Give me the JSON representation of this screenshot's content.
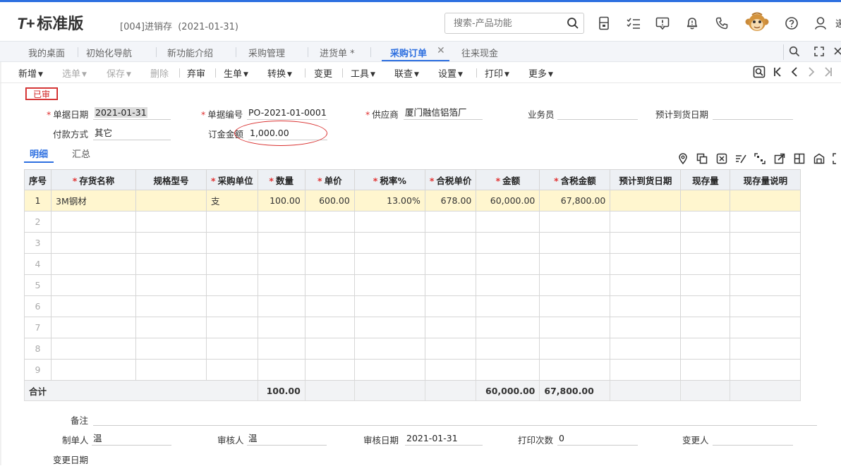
{
  "header": {
    "logo_mark": "T+",
    "logo_text": "标准版",
    "account": "[004]进销存",
    "account_date": "(2021-01-31)",
    "search_placeholder": "搜索-产品功能",
    "cut_text": "递"
  },
  "tabs": [
    {
      "label": "我的桌面"
    },
    {
      "label": "初始化导航"
    },
    {
      "label": "新功能介绍"
    },
    {
      "label": "采购管理"
    },
    {
      "label": "进货单 *"
    },
    {
      "label": "采购订单",
      "active": true
    },
    {
      "label": "往来现金"
    }
  ],
  "tab_close": "✕",
  "toolbar": {
    "new": "新增",
    "select": "选单",
    "save": "保存",
    "delete": "删除",
    "abandon": "弃审",
    "generate": "生单",
    "convert": "转换",
    "change": "变更",
    "tools": "工具",
    "query": "联查",
    "settings": "设置",
    "print": "打印",
    "more": "更多"
  },
  "status": "已审",
  "form": {
    "date_label": "单据日期",
    "date_value": "2021-01-31",
    "code_label": "单据编号",
    "code_value": "PO-2021-01-0001",
    "supplier_label": "供应商",
    "supplier_value": "厦门融信铝箔厂",
    "salesman_label": "业务员",
    "salesman_value": "",
    "arrival_label": "预计到货日期",
    "arrival_value": "",
    "pay_label": "付款方式",
    "pay_value": "其它",
    "deposit_label": "订金金额",
    "deposit_value": "1,000.00"
  },
  "subtabs": {
    "detail": "明细",
    "summary": "汇总"
  },
  "grid": {
    "columns": [
      {
        "label": "序号",
        "req": ""
      },
      {
        "label": "存货名称",
        "req": "*"
      },
      {
        "label": "规格型号",
        "req": ""
      },
      {
        "label": "采购单位",
        "req": "*"
      },
      {
        "label": "数量",
        "req": "*"
      },
      {
        "label": "单价",
        "req": "*"
      },
      {
        "label": "税率%",
        "req": "*"
      },
      {
        "label": "合税单价",
        "req": "*"
      },
      {
        "label": "金额",
        "req": "*"
      },
      {
        "label": "含税金额",
        "req": "*"
      },
      {
        "label": "预计到货日期",
        "req": ""
      },
      {
        "label": "现存量",
        "req": ""
      },
      {
        "label": "现存量说明",
        "req": ""
      }
    ],
    "rows": [
      [
        "1",
        "3M钢材",
        "",
        "支",
        "100.00",
        "600.00",
        "13.00%",
        "678.00",
        "60,000.00",
        "67,800.00",
        "",
        "",
        ""
      ],
      [
        "2",
        "",
        "",
        "",
        "",
        "",
        "",
        "",
        "",
        "",
        "",
        "",
        ""
      ],
      [
        "3",
        "",
        "",
        "",
        "",
        "",
        "",
        "",
        "",
        "",
        "",
        "",
        ""
      ],
      [
        "4",
        "",
        "",
        "",
        "",
        "",
        "",
        "",
        "",
        "",
        "",
        "",
        ""
      ],
      [
        "5",
        "",
        "",
        "",
        "",
        "",
        "",
        "",
        "",
        "",
        "",
        "",
        ""
      ],
      [
        "6",
        "",
        "",
        "",
        "",
        "",
        "",
        "",
        "",
        "",
        "",
        "",
        ""
      ],
      [
        "7",
        "",
        "",
        "",
        "",
        "",
        "",
        "",
        "",
        "",
        "",
        "",
        ""
      ],
      [
        "8",
        "",
        "",
        "",
        "",
        "",
        "",
        "",
        "",
        "",
        "",
        "",
        ""
      ],
      [
        "9",
        "",
        "",
        "",
        "",
        "",
        "",
        "",
        "",
        "",
        "",
        "",
        ""
      ]
    ],
    "total": {
      "label": "合计",
      "qty": "100.00",
      "amount": "60,000.00",
      "tax_amount": "67,800.00"
    }
  },
  "footer": {
    "remark_label": "备注",
    "remark_value": "",
    "maker_label": "制单人",
    "maker_value": "温",
    "auditor_label": "审核人",
    "auditor_value": "温",
    "audit_date_label": "审核日期",
    "audit_date_value": "2021-01-31",
    "print_count_label": "打印次数",
    "print_count_value": "0",
    "changer_label": "变更人",
    "changer_value": "",
    "change_date_label": "变更日期",
    "change_date_value": ""
  },
  "colors": {
    "accent": "#2d6fe0",
    "status_red": "#d02020",
    "selected_row": "#fff6cf",
    "header_bg": "#edf0f4"
  },
  "icons": [
    "search-icon",
    "calculator-icon",
    "checklist-icon",
    "message-icon",
    "bell-icon",
    "phone-icon",
    "monkey-avatar-icon",
    "help-icon",
    "user-icon"
  ]
}
